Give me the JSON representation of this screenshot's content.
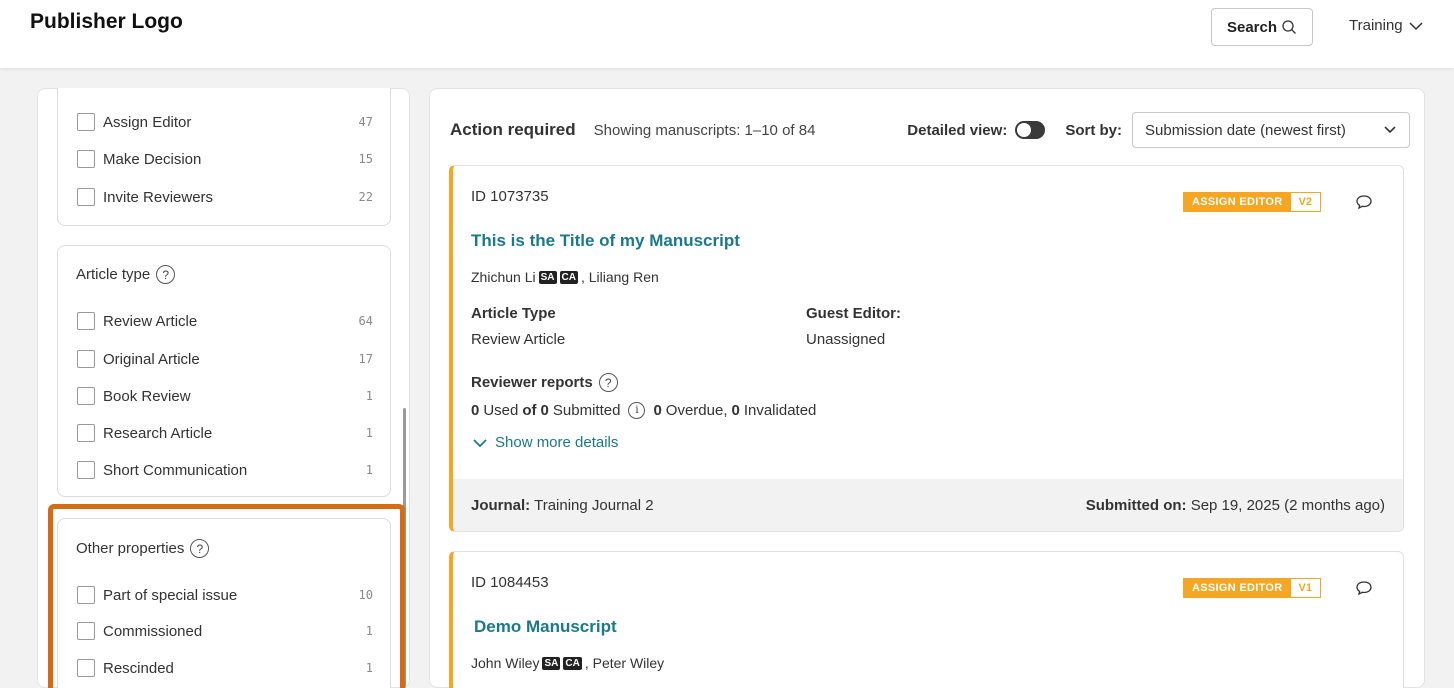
{
  "header": {
    "logo": "Publisher Logo",
    "search_label": "Search",
    "training_label": "Training"
  },
  "filters": {
    "actions": [
      {
        "label": "Assign Editor",
        "count": "47"
      },
      {
        "label": "Make Decision",
        "count": "15"
      },
      {
        "label": "Invite Reviewers",
        "count": "22"
      }
    ],
    "article_type": {
      "title": "Article type",
      "items": [
        {
          "label": "Review Article",
          "count": "64"
        },
        {
          "label": "Original Article",
          "count": "17"
        },
        {
          "label": "Book Review",
          "count": "1"
        },
        {
          "label": "Research Article",
          "count": "1"
        },
        {
          "label": "Short Communication",
          "count": "1"
        }
      ]
    },
    "other": {
      "title": "Other properties",
      "items": [
        {
          "label": "Part of special issue",
          "count": "10"
        },
        {
          "label": "Commissioned",
          "count": "1"
        },
        {
          "label": "Rescinded",
          "count": "1"
        }
      ]
    },
    "help_glyph": "?"
  },
  "list": {
    "title": "Action required",
    "showing": "Showing manuscripts: 1–10 of 84",
    "detailed_view_label": "Detailed view:",
    "sort_label": "Sort by:",
    "sort_value": "Submission date (newest first)"
  },
  "manuscripts": [
    {
      "id": "ID 1073735",
      "status": "ASSIGN EDITOR",
      "version": "V2",
      "title": "This is the Title of my Manuscript",
      "author1": "Zhichun Li",
      "tag_sa": "SA",
      "tag_ca": "CA",
      "author2": ", Liliang Ren",
      "article_type_label": "Article Type",
      "article_type_value": "Review Article",
      "guest_editor_label": "Guest Editor:",
      "guest_editor_value": "Unassigned",
      "reviewer_reports_label": "Reviewer reports",
      "used_count": "0",
      "used_label": "Used",
      "of_label": "of",
      "submitted_count": "0",
      "submitted_label": "Submitted",
      "info_glyph": "i",
      "overdue_count": "0",
      "overdue_label": "Overdue,",
      "invalidated_count": "0",
      "invalidated_label": "Invalidated",
      "show_more": "Show more details",
      "journal_label": "Journal:",
      "journal_value": "Training Journal 2",
      "submitted_on_label": "Submitted on:",
      "submitted_on_value": "Sep 19, 2025 (2 months ago)"
    },
    {
      "id": "ID 1084453",
      "status": "ASSIGN EDITOR",
      "version": "V1",
      "title": "Demo Manuscript",
      "author1": "John Wiley",
      "tag_sa": "SA",
      "tag_ca": "CA",
      "author2": ", Peter Wiley"
    }
  ],
  "colors": {
    "accent_teal": "#1a7a8c",
    "status_orange": "#f5a623",
    "highlight_orange": "#d76a17"
  },
  "icons": [
    "search-icon",
    "chevron-down-icon",
    "help-icon",
    "comment-icon",
    "info-icon"
  ]
}
